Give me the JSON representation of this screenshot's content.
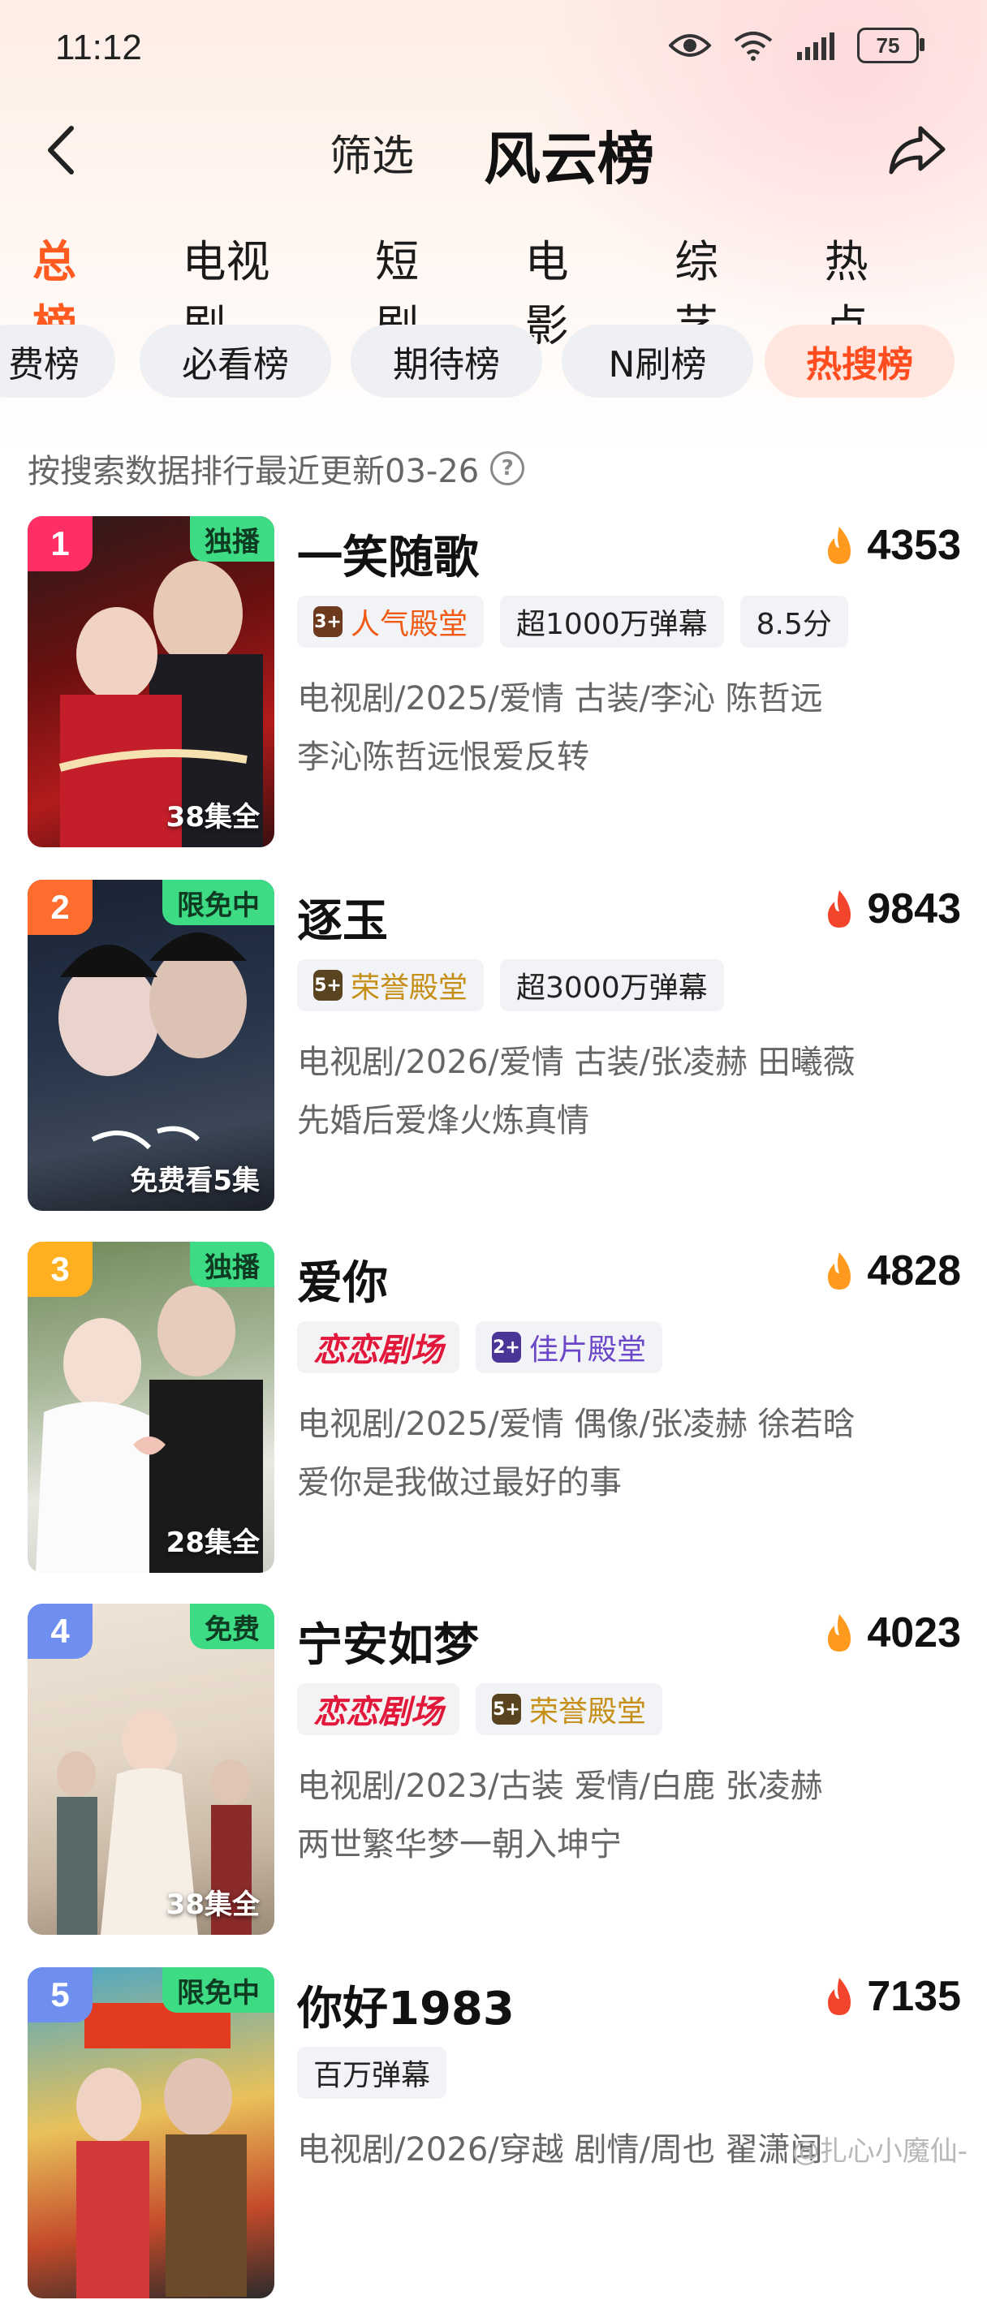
{
  "status_bar": {
    "time": "11:12",
    "battery": "75"
  },
  "header": {
    "filter_label": "筛选",
    "title": "风云榜"
  },
  "tabs": [
    {
      "label": "总榜",
      "active": true
    },
    {
      "label": "电视剧",
      "active": false
    },
    {
      "label": "短剧",
      "active": false
    },
    {
      "label": "电影",
      "active": false
    },
    {
      "label": "综艺",
      "active": false
    },
    {
      "label": "热点",
      "active": false
    }
  ],
  "chips": [
    {
      "label": "费榜",
      "active": false
    },
    {
      "label": "必看榜",
      "active": false
    },
    {
      "label": "期待榜",
      "active": false
    },
    {
      "label": "N刷榜",
      "active": false
    },
    {
      "label": "热搜榜",
      "active": true
    }
  ],
  "subinfo": {
    "text": "按搜索数据排行最近更新03-26",
    "help": "?"
  },
  "items": [
    {
      "rank": "1",
      "rank_color": "#ff2e63",
      "tag": "独播",
      "episodes": "38集全",
      "name": "一笑随歌",
      "score": "4353",
      "badges": [
        {
          "text": "人气殿堂",
          "style": "orange",
          "icon": "3+"
        },
        {
          "text": "超1000万弹幕",
          "style": "plain"
        },
        {
          "text": "8.5分",
          "style": "plain"
        }
      ],
      "meta": "电视剧/2025/爱情 古装/李沁 陈哲远",
      "desc": "李沁陈哲远恨爱反转"
    },
    {
      "rank": "2",
      "rank_color": "#ff6d2e",
      "tag": "限免中",
      "episodes": "免费看5集",
      "name": "逐玉",
      "score": "9843",
      "badges": [
        {
          "text": "荣誉殿堂",
          "style": "gold",
          "icon": "5+"
        },
        {
          "text": "超3000万弹幕",
          "style": "plain"
        }
      ],
      "meta": "电视剧/2026/爱情 古装/张凌赫 田曦薇",
      "desc": "先婚后爱烽火炼真情"
    },
    {
      "rank": "3",
      "rank_color": "#ffb020",
      "tag": "独播",
      "episodes": "28集全",
      "name": "爱你",
      "score": "4828",
      "badges": [
        {
          "text": "恋恋剧场",
          "style": "love"
        },
        {
          "text": "佳片殿堂",
          "style": "purple",
          "icon": "2+"
        }
      ],
      "meta": "电视剧/2025/爱情 偶像/张凌赫 徐若晗",
      "desc": "爱你是我做过最好的事"
    },
    {
      "rank": "4",
      "rank_color": "#6f8ff0",
      "tag": "免费",
      "episodes": "38集全",
      "name": "宁安如梦",
      "score": "4023",
      "badges": [
        {
          "text": "恋恋剧场",
          "style": "love"
        },
        {
          "text": "荣誉殿堂",
          "style": "gold",
          "icon": "5+"
        }
      ],
      "meta": "电视剧/2023/古装 爱情/白鹿 张凌赫",
      "desc": "两世繁华梦一朝入坤宁"
    },
    {
      "rank": "5",
      "rank_color": "#6f8ff0",
      "tag": "限免中",
      "episodes": "",
      "name": "你好1983",
      "score": "7135",
      "badges": [
        {
          "text": "百万弹幕",
          "style": "plain"
        }
      ],
      "meta": "电视剧/2026/穿越 剧情/周也 翟潇闻",
      "desc": ""
    }
  ],
  "watermark": "@扎心小魔仙-",
  "colors": {
    "accent": "#ff5a1f",
    "tag_green": "#3ddc84"
  }
}
